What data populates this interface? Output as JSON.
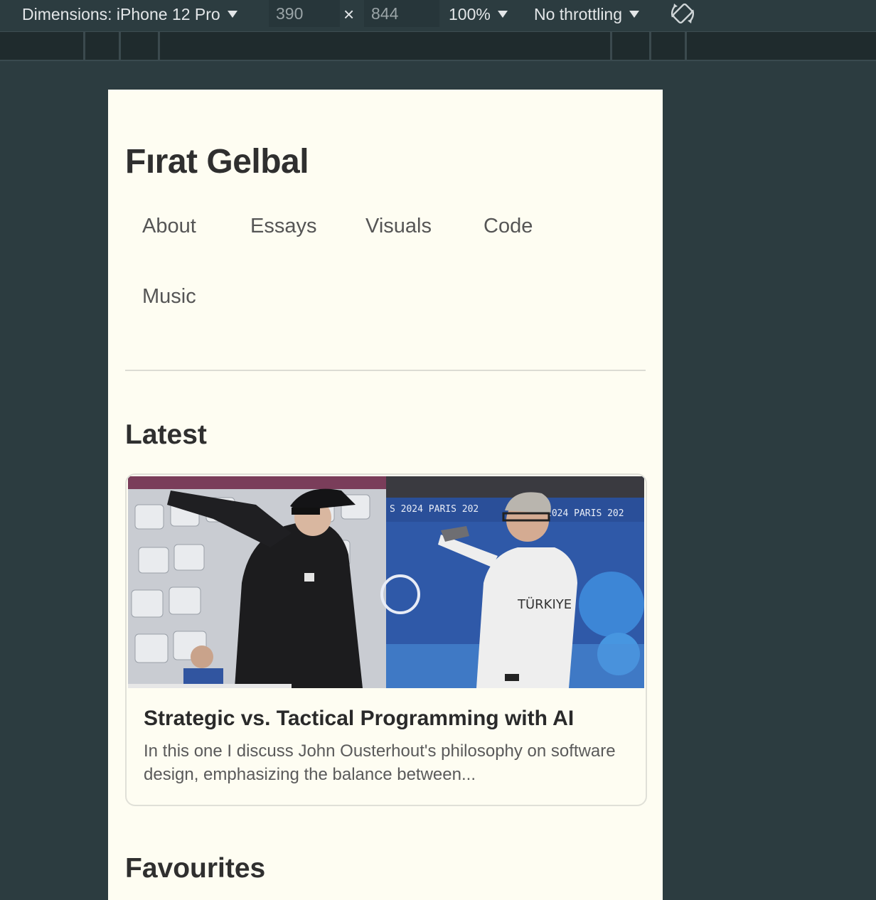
{
  "devtools": {
    "dimensions_label": "Dimensions: iPhone 12 Pro",
    "width_value": "390",
    "height_value": "844",
    "times_symbol": "×",
    "zoom_label": "100%",
    "throttling_label": "No throttling",
    "rotate_icon": "rotate-icon"
  },
  "site": {
    "title": "Fırat Gelbal",
    "nav": [
      "About",
      "Essays",
      "Visuals",
      "Code",
      "Music"
    ]
  },
  "latest": {
    "heading": "Latest",
    "card": {
      "title": "Strategic vs. Tactical Programming with AI",
      "excerpt": "In this one I discuss John Ousterhout's philosophy on software design, emphasizing the balance between...",
      "image_left_text": "",
      "image_right_banner": "S 2024  PARIS 202",
      "image_right_banner2": "2024  PARIS 202",
      "image_shirt_text": "TÜRKIYE"
    }
  },
  "favourites": {
    "heading": "Favourites"
  }
}
